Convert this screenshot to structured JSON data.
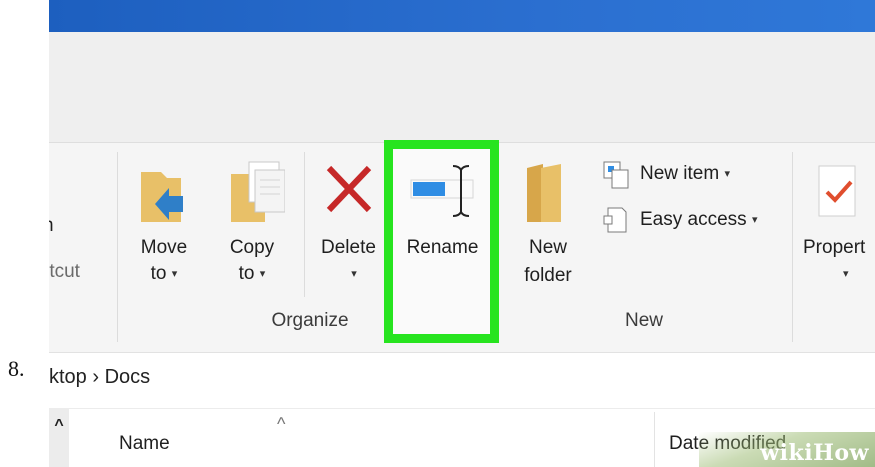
{
  "step_number": "8.",
  "ribbon": {
    "left_partial": {
      "line1": "n",
      "line2": "rtcut"
    },
    "organize": {
      "group_label": "Organize",
      "move": {
        "line1": "Move",
        "line2": "to",
        "caret": "▾"
      },
      "copy": {
        "line1": "Copy",
        "line2": "to",
        "caret": "▾"
      },
      "delete": {
        "line1": "Delete",
        "caret": "▾"
      },
      "rename": {
        "line1": "Rename"
      }
    },
    "new": {
      "group_label": "New",
      "new_folder": {
        "line1": "New",
        "line2": "folder"
      },
      "new_item": {
        "label": "New item",
        "caret": "▾"
      },
      "easy_access": {
        "label": "Easy access",
        "caret": "▾"
      }
    },
    "properties": {
      "line1": "Propert",
      "caret": "▾"
    }
  },
  "address_bar": {
    "path": "ktop  ›  Docs"
  },
  "file_list": {
    "sort_indicator": "^",
    "scroll_up": "^",
    "columns": [
      "Name",
      "Date modified"
    ]
  },
  "watermark": "wikiHow",
  "colors": {
    "highlight": "#27e41f",
    "titlebar": "#2b6fd0",
    "folder": "#e8c068",
    "delete_x": "#c62828",
    "rename_blue": "#2f8de4"
  }
}
